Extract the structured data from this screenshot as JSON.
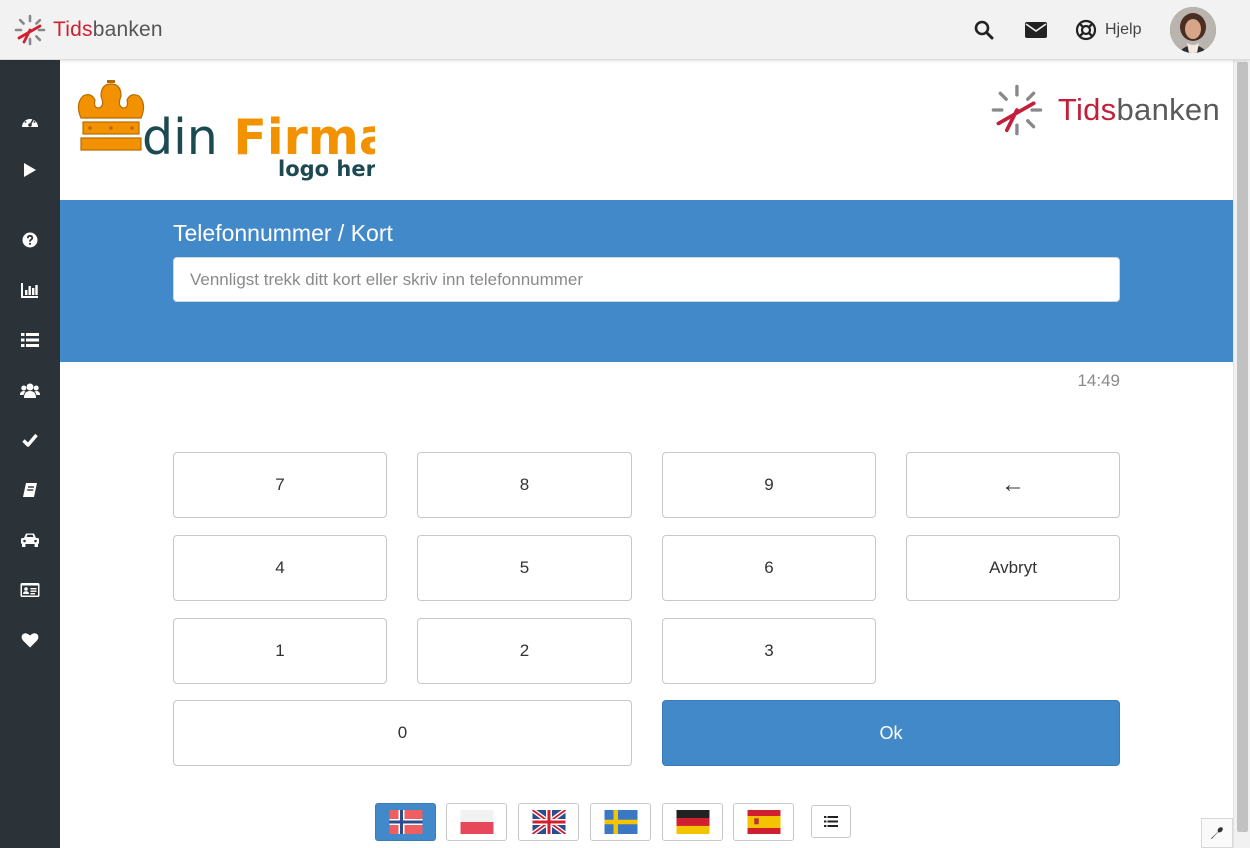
{
  "header": {
    "brand_part1": "Tids",
    "brand_part2": "banken",
    "icons": [
      "search-icon",
      "envelope-icon",
      "life-ring-icon"
    ],
    "help_label": "Hjelp"
  },
  "sidebar": {
    "items": [
      "dashboard-icon",
      "play-icon",
      "question-icon",
      "bar-chart-icon",
      "list-icon",
      "users-icon",
      "check-icon",
      "book-icon",
      "car-icon",
      "id-card-icon",
      "heart-icon"
    ]
  },
  "logos": {
    "company_part1": "din",
    "company_part2": "Firma",
    "company_sub": "logo her",
    "tids_part1": "Tids",
    "tids_part2": "banken"
  },
  "form": {
    "label": "Telefonnummer / Kort",
    "input_value": "",
    "placeholder": "Vennligst trekk ditt kort eller skriv inn telefonnummer"
  },
  "clock": "14:49",
  "keypad": {
    "k7": "7",
    "k8": "8",
    "k9": "9",
    "back": "←",
    "k4": "4",
    "k5": "5",
    "k6": "6",
    "cancel": "Avbryt",
    "k1": "1",
    "k2": "2",
    "k3": "3",
    "k0": "0",
    "ok": "Ok"
  },
  "languages": {
    "flags": [
      "norway-flag",
      "poland-flag",
      "uk-flag",
      "sweden-flag",
      "germany-flag",
      "spain-flag"
    ],
    "active": "norway-flag",
    "extra": "list-icon"
  },
  "colors": {
    "accent": "#4289c9",
    "brand_red": "#d0202f",
    "sidebar_bg": "#2c3338",
    "logo_orange": "#f39200",
    "logo_dark": "#1d4a52"
  }
}
